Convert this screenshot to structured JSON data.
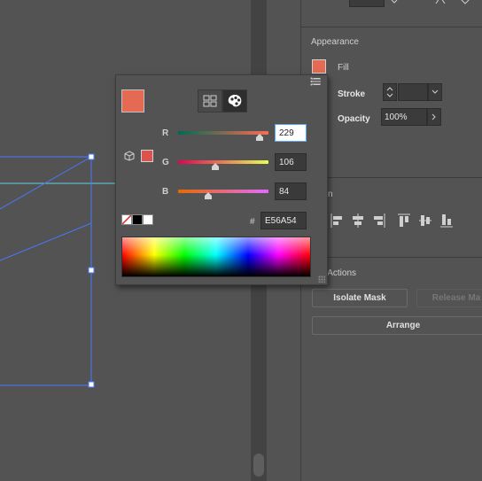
{
  "appearance": {
    "section_title": "Appearance",
    "fill_label": "Fill",
    "stroke_label": "Stroke",
    "opacity_label": "Opacity",
    "opacity_value": "100%",
    "fill_color": "#E56A54"
  },
  "align_section": {
    "title_fragment": "n"
  },
  "actions": {
    "title_fragment": "k Actions",
    "isolate_mask_label": "Isolate Mask",
    "release_mask_label": "Release Ma",
    "arrange_label": "Arrange"
  },
  "color_picker": {
    "current_color": "#E56A54",
    "channels": [
      {
        "name": "R",
        "value": "229",
        "level": 0.898
      },
      {
        "name": "G",
        "value": "106",
        "level": 0.416
      },
      {
        "name": "B",
        "value": "84",
        "level": 0.329
      }
    ],
    "hex_prefix": "#",
    "hex_value": "E56A54",
    "modes": [
      "swatches-grid-icon",
      "color-palette-icon"
    ],
    "active_mode": "color-palette-icon"
  },
  "colors": {
    "selection": "#4a78ff",
    "accent_input_border": "#5ba8ff"
  }
}
